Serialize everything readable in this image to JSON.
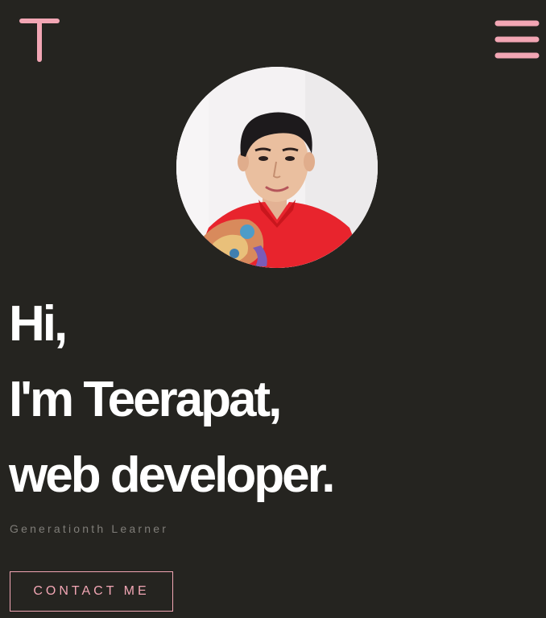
{
  "header": {
    "logo_icon": "letter-t-logo-icon",
    "menu_icon": "hamburger-menu-icon"
  },
  "profile": {
    "photo_icon": "profile-photo"
  },
  "hero": {
    "line1": "Hi,",
    "line2": "I'm Teerapat,",
    "line3": "web developer.",
    "subtitle": "Generationth Learner",
    "contact_label": "CONTACT ME"
  },
  "colors": {
    "background": "#252420",
    "accent": "#f2a6b4",
    "heading": "#ffffff",
    "subtitle": "#7f7d78"
  }
}
